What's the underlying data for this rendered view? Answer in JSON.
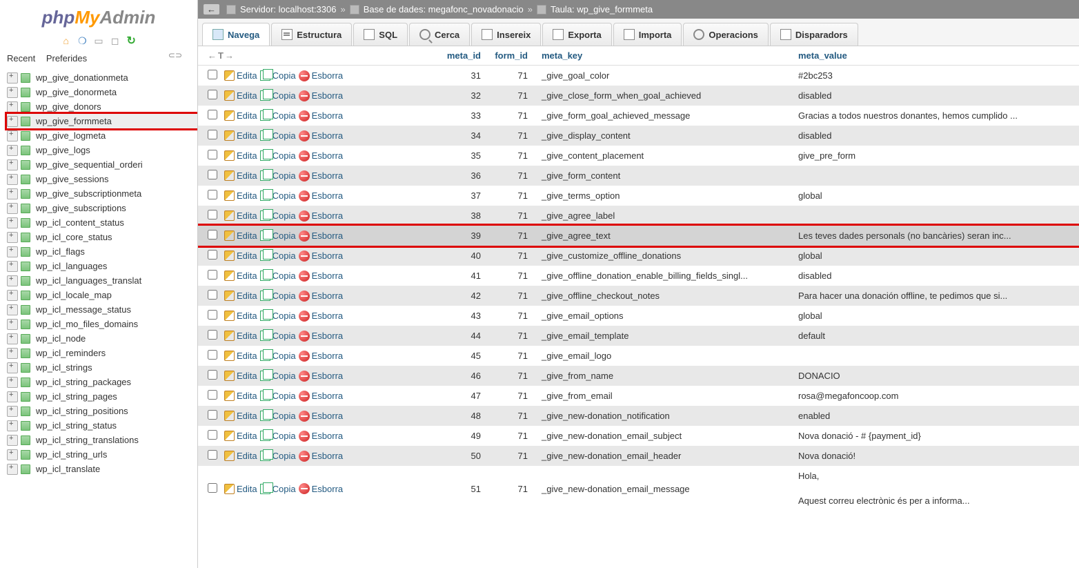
{
  "logo": {
    "php": "php",
    "my": "My",
    "admin": "Admin"
  },
  "sidebar_tabs": {
    "recent": "Recent",
    "preferides": "Preferides"
  },
  "breadcrumb": {
    "server_label": "Servidor: localhost:3306",
    "db_label": "Base de dades: megafonc_novadonacio",
    "table_label": "Taula: wp_give_formmeta"
  },
  "tabs": [
    {
      "label": "Navega",
      "name": "browse",
      "active": true
    },
    {
      "label": "Estructura",
      "name": "structure"
    },
    {
      "label": "SQL",
      "name": "sql"
    },
    {
      "label": "Cerca",
      "name": "search"
    },
    {
      "label": "Insereix",
      "name": "insert"
    },
    {
      "label": "Exporta",
      "name": "export"
    },
    {
      "label": "Importa",
      "name": "import"
    },
    {
      "label": "Operacions",
      "name": "operations"
    },
    {
      "label": "Disparadors",
      "name": "triggers"
    }
  ],
  "columns": {
    "meta_id": "meta_id",
    "form_id": "form_id",
    "meta_key": "meta_key",
    "meta_value": "meta_value"
  },
  "actions": {
    "edit": "Edita",
    "copy": "Copia",
    "delete": "Esborra"
  },
  "highlighted_table": "wp_give_formmeta",
  "tree": [
    "wp_give_donationmeta",
    "wp_give_donormeta",
    "wp_give_donors",
    "wp_give_formmeta",
    "wp_give_logmeta",
    "wp_give_logs",
    "wp_give_sequential_orderi",
    "wp_give_sessions",
    "wp_give_subscriptionmeta",
    "wp_give_subscriptions",
    "wp_icl_content_status",
    "wp_icl_core_status",
    "wp_icl_flags",
    "wp_icl_languages",
    "wp_icl_languages_translat",
    "wp_icl_locale_map",
    "wp_icl_message_status",
    "wp_icl_mo_files_domains",
    "wp_icl_node",
    "wp_icl_reminders",
    "wp_icl_strings",
    "wp_icl_string_packages",
    "wp_icl_string_pages",
    "wp_icl_string_positions",
    "wp_icl_string_status",
    "wp_icl_string_translations",
    "wp_icl_string_urls",
    "wp_icl_translate"
  ],
  "rows": [
    {
      "meta_id": "31",
      "form_id": "71",
      "meta_key": "_give_goal_color",
      "meta_value": "#2bc253"
    },
    {
      "meta_id": "32",
      "form_id": "71",
      "meta_key": "_give_close_form_when_goal_achieved",
      "meta_value": "disabled"
    },
    {
      "meta_id": "33",
      "form_id": "71",
      "meta_key": "_give_form_goal_achieved_message",
      "meta_value": "Gracias a todos nuestros donantes, hemos cumplido ..."
    },
    {
      "meta_id": "34",
      "form_id": "71",
      "meta_key": "_give_display_content",
      "meta_value": "disabled"
    },
    {
      "meta_id": "35",
      "form_id": "71",
      "meta_key": "_give_content_placement",
      "meta_value": "give_pre_form"
    },
    {
      "meta_id": "36",
      "form_id": "71",
      "meta_key": "_give_form_content",
      "meta_value": ""
    },
    {
      "meta_id": "37",
      "form_id": "71",
      "meta_key": "_give_terms_option",
      "meta_value": "global"
    },
    {
      "meta_id": "38",
      "form_id": "71",
      "meta_key": "_give_agree_label",
      "meta_value": ""
    },
    {
      "meta_id": "39",
      "form_id": "71",
      "meta_key": "_give_agree_text",
      "meta_value": "Les teves dades personals (no bancàries) seran inc...",
      "hl": true
    },
    {
      "meta_id": "40",
      "form_id": "71",
      "meta_key": "_give_customize_offline_donations",
      "meta_value": "global"
    },
    {
      "meta_id": "41",
      "form_id": "71",
      "meta_key": "_give_offline_donation_enable_billing_fields_singl...",
      "meta_value": "disabled"
    },
    {
      "meta_id": "42",
      "form_id": "71",
      "meta_key": "_give_offline_checkout_notes",
      "meta_value": "Para hacer una donación offline, te pedimos que si..."
    },
    {
      "meta_id": "43",
      "form_id": "71",
      "meta_key": "_give_email_options",
      "meta_value": "global"
    },
    {
      "meta_id": "44",
      "form_id": "71",
      "meta_key": "_give_email_template",
      "meta_value": "default"
    },
    {
      "meta_id": "45",
      "form_id": "71",
      "meta_key": "_give_email_logo",
      "meta_value": ""
    },
    {
      "meta_id": "46",
      "form_id": "71",
      "meta_key": "_give_from_name",
      "meta_value": "DONACIO"
    },
    {
      "meta_id": "47",
      "form_id": "71",
      "meta_key": "_give_from_email",
      "meta_value": "rosa@megafoncoop.com"
    },
    {
      "meta_id": "48",
      "form_id": "71",
      "meta_key": "_give_new-donation_notification",
      "meta_value": "enabled"
    },
    {
      "meta_id": "49",
      "form_id": "71",
      "meta_key": "_give_new-donation_email_subject",
      "meta_value": "Nova donació - # {payment_id}"
    },
    {
      "meta_id": "50",
      "form_id": "71",
      "meta_key": "_give_new-donation_email_header",
      "meta_value": "Nova donació!"
    },
    {
      "meta_id": "51",
      "form_id": "71",
      "meta_key": "_give_new-donation_email_message",
      "meta_value": "Hola,\n\nAquest correu electrònic és per a informa..."
    }
  ]
}
